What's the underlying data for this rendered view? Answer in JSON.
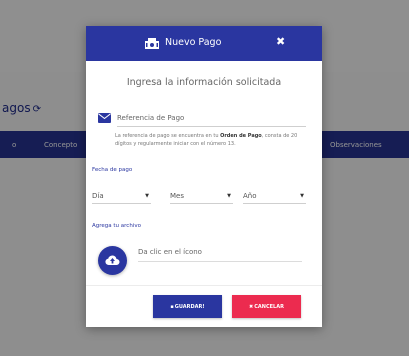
{
  "background": {
    "page_title": "agos",
    "table_headers": [
      "o",
      "Concepto",
      "Observaciones"
    ]
  },
  "modal": {
    "title": "Nuevo Pago",
    "close": "✖",
    "subtitle": "Ingresa la información solicitada",
    "reference": {
      "placeholder": "Referencia de Pago",
      "help_before": "La referencia de pago se encuentra en tu ",
      "help_bold": "Orden de Pago",
      "help_after": ", consta de 20 dígitos y regularmente iniciar con el número 13."
    },
    "date": {
      "label": "Fecha de pago",
      "day": "Día",
      "month": "Mes",
      "year": "Año",
      "caret": "▼"
    },
    "file": {
      "label": "Agrega tu archivo",
      "hint": "Da clic en el ícono"
    },
    "buttons": {
      "save": "GUARDAR!",
      "cancel": "CANCELAR"
    }
  },
  "colors": {
    "primary": "#2a36a0",
    "danger": "#ec2b4f"
  },
  "icons": {
    "header": "money-icon",
    "reference": "envelope-icon",
    "upload": "cloud-upload-icon",
    "save": "floppy-icon",
    "cancel": "x-icon"
  }
}
